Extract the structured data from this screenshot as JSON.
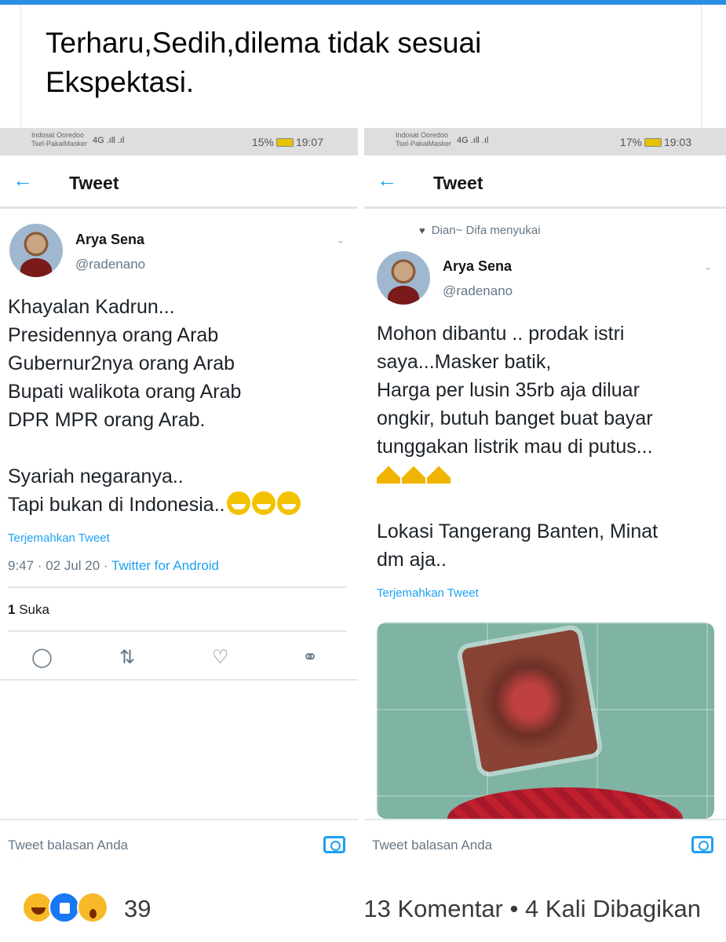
{
  "post": {
    "text": "Terharu,Sedih,dilema tidak sesuai Ekspektasi."
  },
  "left_screenshot": {
    "status": {
      "carrier": "Indosat Ooredoo\nTsel-PakaiMasker",
      "signal": "4G .ıll .ıl",
      "battery": "15%",
      "time": "19:07"
    },
    "header": {
      "title": "Tweet"
    },
    "tweet": {
      "author_name": "Arya Sena",
      "author_handle": "@radenano",
      "text": "Khayalan Kadrun...\nPresidennya orang Arab\nGubernur2nya orang Arab\nBupati walikota orang Arab\nDPR MPR orang Arab.\n\nSyariah negaranya..\nTapi bukan di Indonesia..",
      "translate_label": "Terjemahkan Tweet",
      "timestamp": "9:47 · 02 Jul 20 · ",
      "source": "Twitter for Android",
      "likes_count": "1",
      "likes_label": "Suka"
    },
    "reply_placeholder": "Tweet balasan Anda"
  },
  "right_screenshot": {
    "status": {
      "carrier": "Indosat Ooredoo\nTsel-PakaiMasker",
      "signal": "4G .ıll .ıl",
      "battery": "17%",
      "time": "19:03"
    },
    "header": {
      "title": "Tweet"
    },
    "liked_by": "Dian~ Difa menyukai",
    "tweet": {
      "author_name": "Arya Sena",
      "author_handle": "@radenano",
      "text": "Mohon dibantu .. prodak istri\nsaya...Masker batik,\nHarga per lusin 35rb aja diluar\nongkir, butuh banget buat bayar\ntunggakan listrik mau di putus...",
      "text2": "Lokasi Tangerang Banten, Minat\ndm aja..",
      "translate_label": "Terjemahkan Tweet"
    },
    "reply_placeholder": "Tweet balasan Anda"
  },
  "footer": {
    "reaction_count": "39",
    "stats": "13 Komentar • 4 Kali Dibagikan"
  },
  "icons": {
    "back": "arrow-left-icon",
    "reply": "comment-icon",
    "retweet": "retweet-icon",
    "like": "heart-icon",
    "share": "share-icon",
    "camera": "camera-icon"
  },
  "colors": {
    "accent": "#1da1f2",
    "facebook_blue": "#1877f2",
    "top_bar": "#2b8ee6"
  }
}
